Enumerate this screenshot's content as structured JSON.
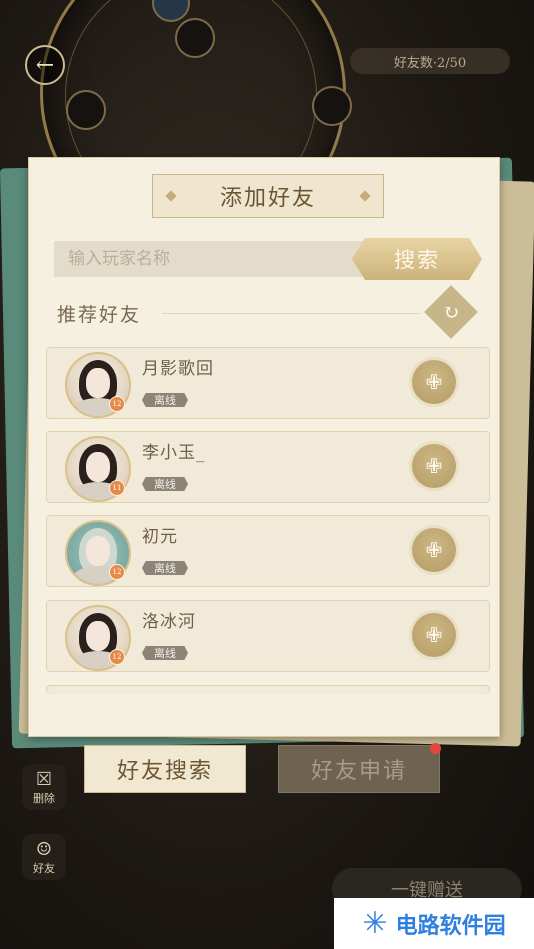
{
  "header": {
    "back_icon": "back-arrow-icon",
    "top_pill": "好友数·2/50"
  },
  "dialog": {
    "title": "添加好友",
    "search_placeholder": "输入玩家名称",
    "search_button": "搜索",
    "recommend_title": "推荐好友",
    "refresh_icon": "refresh-icon"
  },
  "friends": [
    {
      "name": "月影歌回",
      "status": "离线",
      "level": "12"
    },
    {
      "name": "李小玉_",
      "status": "离线",
      "level": "11"
    },
    {
      "name": "初元",
      "status": "离线",
      "level": "12"
    },
    {
      "name": "洛冰河",
      "status": "离线",
      "level": "12"
    }
  ],
  "tabs": {
    "search": "好友搜索",
    "requests": "好友申请"
  },
  "side": {
    "delete_label": "删除",
    "friend_label": "好友"
  },
  "gift_button": "一键赠送",
  "watermark": "电路软件园",
  "colors": {
    "accent": "#c6b589",
    "paper": "#f6f0e0",
    "notify": "#e2473b",
    "watermark": "#2f7fe0"
  }
}
